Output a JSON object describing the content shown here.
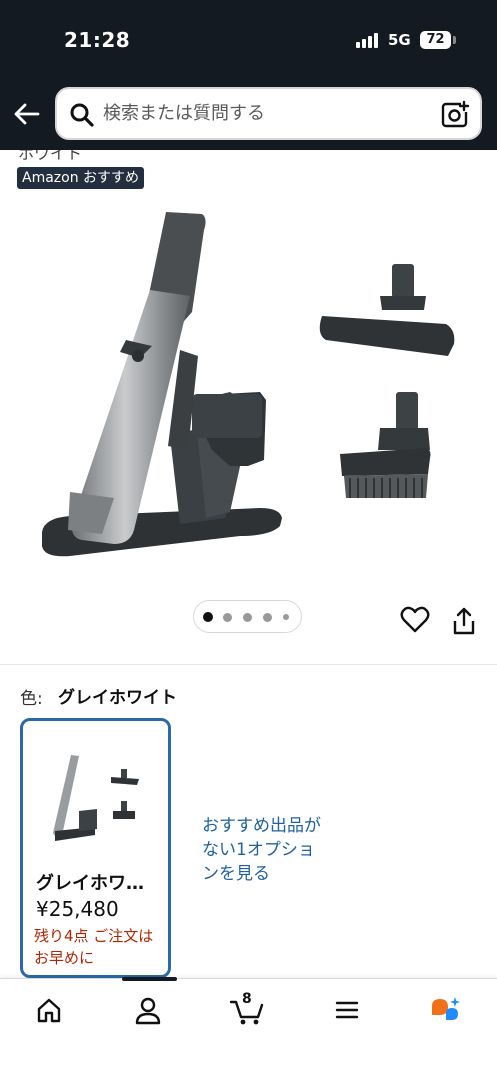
{
  "status_bar": {
    "time": "21:28",
    "network": "5G",
    "battery": "72"
  },
  "header": {
    "search_placeholder": "検索または質問する",
    "icons": [
      "back-arrow-icon",
      "search-icon",
      "camera-scan-icon"
    ]
  },
  "product": {
    "previous_text_fragment": "ホワイト",
    "badge": "Amazon おすすめ",
    "image_carousel": {
      "total": 5,
      "current": 1
    }
  },
  "color_selector": {
    "label": "色:",
    "selected": "グレイホワイト"
  },
  "variant": {
    "name": "グレイホワ…",
    "price": "¥25,480",
    "stock": "残り4点 ご注文はお早めに"
  },
  "other_offers": "おすすめ出品がない1オプションを見る",
  "bottom_nav": {
    "cart_count": "8",
    "items": [
      "home-icon",
      "account-icon",
      "cart-icon",
      "menu-icon",
      "ai-assistant-icon"
    ]
  },
  "colors": {
    "header_bg": "#131a22",
    "badge_bg": "#232f3e",
    "link": "#2162a1",
    "stock_red": "#b12704",
    "selected_border": "#2a6aa8"
  }
}
